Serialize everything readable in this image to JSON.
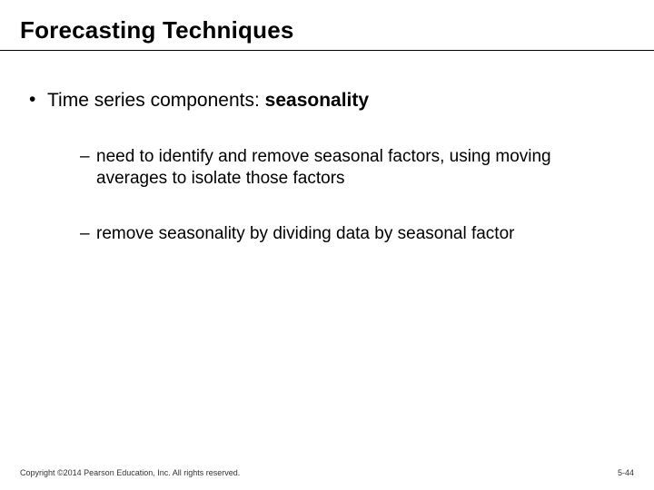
{
  "title": "Forecasting Techniques",
  "bullets": [
    {
      "prefix": "Time series components: ",
      "bold": "seasonality",
      "children": [
        "need to identify and remove seasonal factors, using moving averages to isolate those factors",
        "remove seasonality by dividing data by seasonal factor"
      ]
    }
  ],
  "footer": {
    "copyright": "Copyright ©2014 Pearson Education, Inc. All rights reserved.",
    "page": "5-44"
  }
}
